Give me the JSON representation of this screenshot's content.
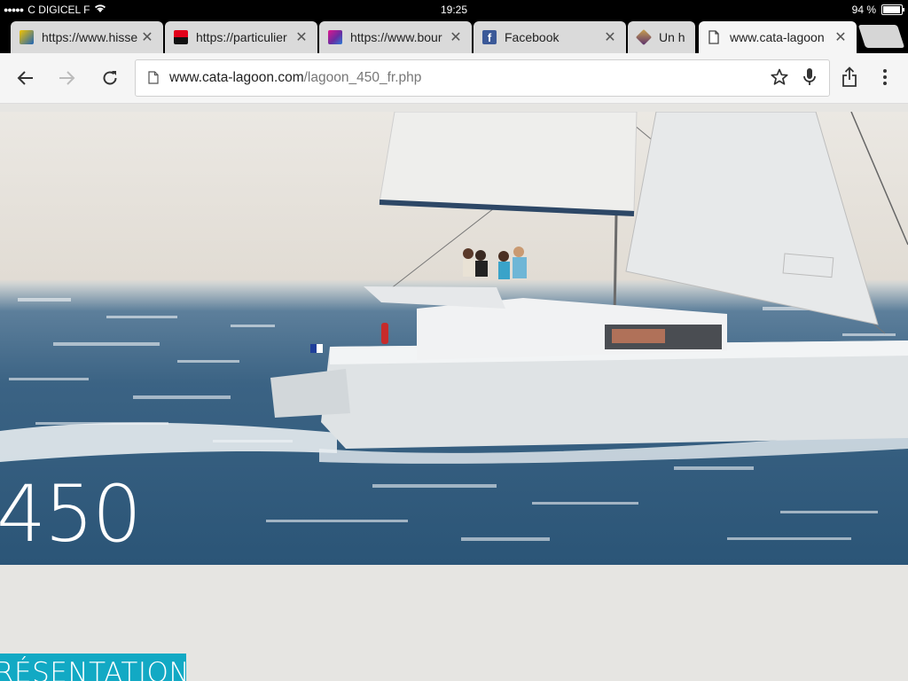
{
  "status": {
    "carrier": "C DIGICEL F",
    "time": "19:25",
    "battery": "94 %"
  },
  "tabs": [
    {
      "title": "https://www.hisse",
      "favicon": "hisse-favicon",
      "active": false
    },
    {
      "title": "https://particulier",
      "favicon": "bank-favicon",
      "active": false
    },
    {
      "title": "https://www.bour",
      "favicon": "bour-favicon",
      "active": false
    },
    {
      "title": "Facebook",
      "favicon": "facebook-favicon",
      "active": false
    },
    {
      "title": "Un h",
      "favicon": "tag-favicon",
      "active": false
    },
    {
      "title": "www.cata-lagoon",
      "favicon": "page-icon",
      "active": true
    }
  ],
  "address": {
    "domain": "www.cata-lagoon.com",
    "path": "/lagoon_450_fr.php"
  },
  "page": {
    "model_number": "450",
    "presentation_label": "RÉSENTATION"
  },
  "colors": {
    "accent": "#12a9c4",
    "facebook": "#3b5998"
  }
}
